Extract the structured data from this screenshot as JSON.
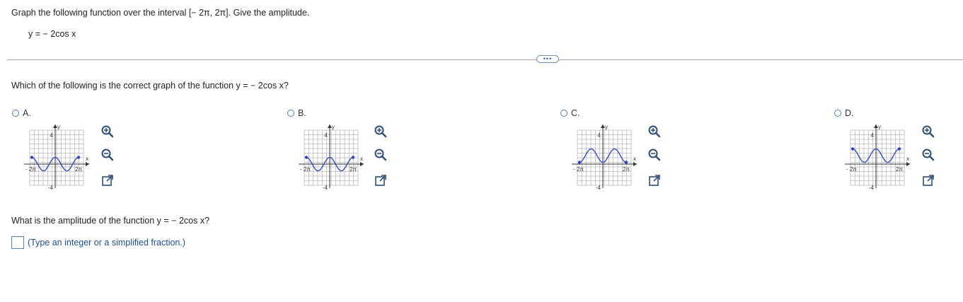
{
  "question": {
    "prompt": "Graph the following function over the interval [− 2π, 2π]. Give the amplitude.",
    "function": "y = − 2cos x"
  },
  "more_button": {
    "label": "•••"
  },
  "part1": {
    "prompt": "Which of the following is the correct graph of the function y = − 2cos x?",
    "choices": [
      {
        "label": "A."
      },
      {
        "label": "B."
      },
      {
        "label": "C."
      },
      {
        "label": "D."
      }
    ],
    "graph_labels": {
      "y_axis": "y",
      "x_axis": "x",
      "y_max": "4",
      "y_min": "-4",
      "x_min": "- 2π",
      "x_max": "2π"
    }
  },
  "part2": {
    "prompt": "What is the amplitude of the function y = − 2cos x?",
    "hint": "(Type an integer or a simplified fraction.)"
  },
  "colors": {
    "curve": "#2b3fd1",
    "grid": "#b9b9b9",
    "link": "#1c4f9c",
    "radio": "#5b7fb0"
  },
  "icons": [
    "zoom-in-icon",
    "zoom-out-icon",
    "expand-icon"
  ]
}
